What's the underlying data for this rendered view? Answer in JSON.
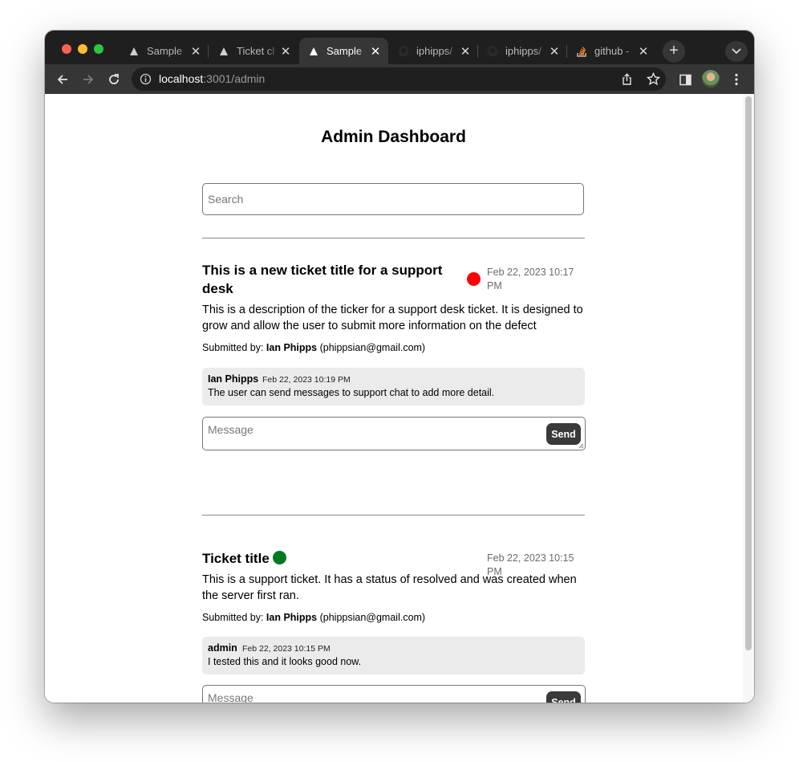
{
  "browser": {
    "tabs": [
      {
        "title": "Sample",
        "icon": "triangle-logo-icon"
      },
      {
        "title": "Ticket cl",
        "icon": "triangle-logo-icon"
      },
      {
        "title": "Sample",
        "icon": "triangle-logo-icon",
        "active": true
      },
      {
        "title": "iphipps/",
        "icon": "github-icon"
      },
      {
        "title": "iphipps/",
        "icon": "github-icon"
      },
      {
        "title": "github -",
        "icon": "stackoverflow-icon"
      }
    ],
    "close_glyph": "✕",
    "new_tab_glyph": "+",
    "url_host": "localhost",
    "url_rest": ":3001/admin"
  },
  "page": {
    "title": "Admin Dashboard",
    "search_placeholder": "Search",
    "submitted_label": "Submitted by:",
    "message_placeholder": "Message",
    "send_label": "Send"
  },
  "tickets": [
    {
      "title_line1": "This is a new ticket title for a support",
      "title_line2": "desk",
      "status_color": "#ff0000",
      "status": "open",
      "date_line1": "Feb 22, 2023 10:17",
      "date_line2": "PM",
      "desc_line1": "This is a description of the ticker for a support desk ticket. It is designed to",
      "desc_line2": "grow and allow the user to submit more information on the defect",
      "submitter_name": "Ian Phipps",
      "submitter_email": "(phippsian@gmail.com)",
      "message": {
        "author": "Ian Phipps",
        "date": "Feb 22, 2023 10:19 PM",
        "text": "The user can send messages to support chat to add more detail."
      }
    },
    {
      "title_line1": "Ticket title",
      "status_color": "#007a1f",
      "status": "resolved",
      "date_line1": "Feb 22, 2023 10:15 PM",
      "desc_line1": "This is a support ticket. It has a status of resolved and was created when",
      "desc_line2": "the server first ran.",
      "submitter_name": "Ian Phipps",
      "submitter_email": "(phippsian@gmail.com)",
      "message": {
        "author": "admin",
        "date": "Feb 22, 2023 10:15 PM",
        "text": "I tested this and it looks good now."
      }
    }
  ]
}
